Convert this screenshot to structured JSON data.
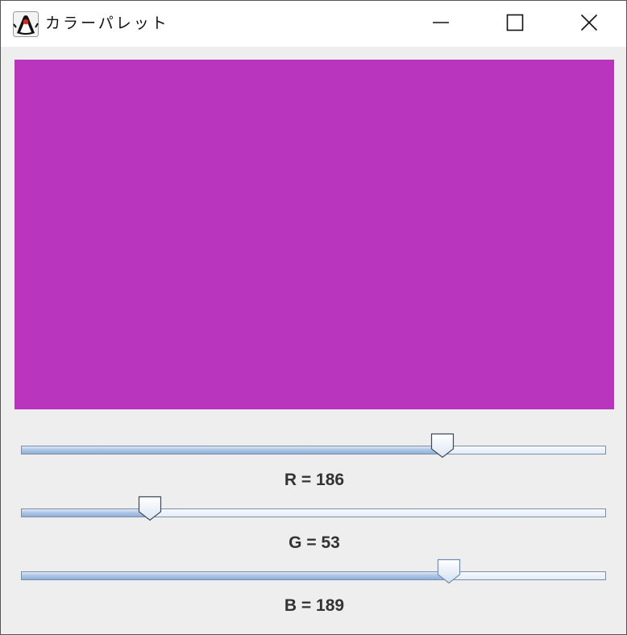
{
  "window": {
    "title": "カラーパレット",
    "icon": "java-duke-icon",
    "controls": [
      "minimize-icon",
      "maximize-icon",
      "close-icon"
    ]
  },
  "preview": {
    "color": "#ba35bd"
  },
  "sliders": [
    {
      "channel": "R",
      "value": 186,
      "max": 255,
      "label": "R = 186"
    },
    {
      "channel": "G",
      "value": 53,
      "max": 255,
      "label": "G = 53"
    },
    {
      "channel": "B",
      "value": 189,
      "max": 255,
      "label": "B = 189"
    }
  ]
}
